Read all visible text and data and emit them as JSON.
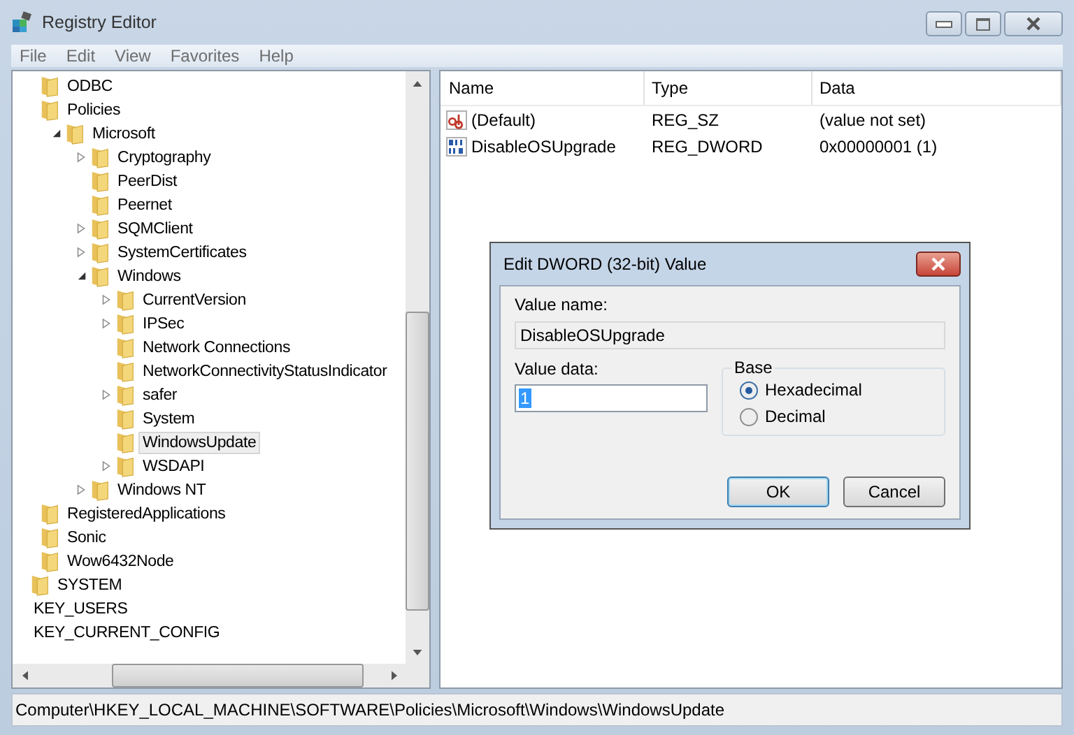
{
  "window": {
    "title": "Registry Editor"
  },
  "menu": [
    "File",
    "Edit",
    "View",
    "Favorites",
    "Help"
  ],
  "tree": {
    "keys": [
      {
        "label": "ODBC",
        "selected": false
      },
      {
        "label": "Policies",
        "selected": false,
        "children": [
          {
            "label": "Microsoft",
            "expanded": true,
            "selected": false,
            "children": [
              {
                "label": "Cryptography",
                "expanded": false,
                "selected": false
              },
              {
                "label": "PeerDist",
                "selected": false
              },
              {
                "label": "Peernet",
                "selected": false
              },
              {
                "label": "SQMClient",
                "expanded": false,
                "selected": false
              },
              {
                "label": "SystemCertificates",
                "expanded": false,
                "selected": false
              },
              {
                "label": "Windows",
                "expanded": true,
                "selected": false,
                "children": [
                  {
                    "label": "CurrentVersion",
                    "expanded": false,
                    "selected": false
                  },
                  {
                    "label": "IPSec",
                    "expanded": false,
                    "selected": false
                  },
                  {
                    "label": "Network Connections",
                    "selected": false
                  },
                  {
                    "label": "NetworkConnectivityStatusIndicator",
                    "selected": false
                  },
                  {
                    "label": "safer",
                    "expanded": false,
                    "selected": false
                  },
                  {
                    "label": "System",
                    "selected": false
                  },
                  {
                    "label": "WindowsUpdate",
                    "selected": true
                  },
                  {
                    "label": "WSDAPI",
                    "expanded": false,
                    "selected": false
                  }
                ]
              },
              {
                "label": "Windows NT",
                "expanded": false,
                "selected": false
              }
            ]
          }
        ]
      },
      {
        "label": "RegisteredApplications",
        "selected": false
      },
      {
        "label": "Sonic",
        "selected": false
      },
      {
        "label": "Wow6432Node",
        "selected": false
      }
    ],
    "parent_siblings": [
      {
        "label": "SYSTEM",
        "selected": false
      }
    ],
    "hives": [
      {
        "label": "KEY_USERS",
        "selected": false
      },
      {
        "label": "KEY_CURRENT_CONFIG",
        "selected": false
      }
    ]
  },
  "values": {
    "columns": [
      "Name",
      "Type",
      "Data"
    ],
    "rows": [
      {
        "kind": "string",
        "name": "(Default)",
        "type": "REG_SZ",
        "data": "(value not set)"
      },
      {
        "kind": "binary",
        "name": "DisableOSUpgrade",
        "type": "REG_DWORD",
        "data": "0x00000001 (1)"
      }
    ]
  },
  "dialog": {
    "title": "Edit DWORD (32-bit) Value",
    "value_name_label": "Value name:",
    "value_name": "DisableOSUpgrade",
    "value_data_label": "Value data:",
    "value_data": "1",
    "base_label": "Base",
    "bases": [
      {
        "label": "Hexadecimal",
        "selected": true
      },
      {
        "label": "Decimal",
        "selected": false
      }
    ],
    "buttons": [
      {
        "label": "OK",
        "default": true
      },
      {
        "label": "Cancel",
        "default": false
      }
    ]
  },
  "status_bar": "Computer\\HKEY_LOCAL_MACHINE\\SOFTWARE\\Policies\\Microsoft\\Windows\\WindowsUpdate"
}
